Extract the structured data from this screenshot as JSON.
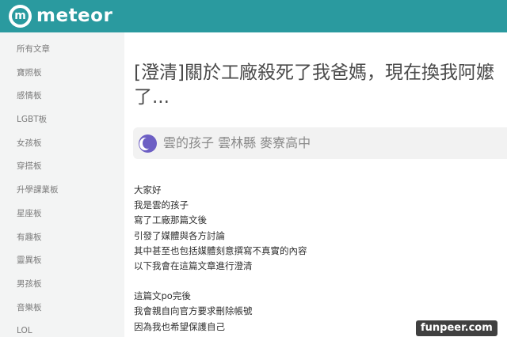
{
  "brand": {
    "logo_glyph": "m",
    "name": "meteor",
    "color": "#2a9a9f"
  },
  "sidebar": {
    "items": [
      {
        "label": "所有文章"
      },
      {
        "label": "寶照板"
      },
      {
        "label": "感情板"
      },
      {
        "label": "LGBT板"
      },
      {
        "label": "女孩板"
      },
      {
        "label": "穿搭板"
      },
      {
        "label": "升學課業板"
      },
      {
        "label": "星座板"
      },
      {
        "label": "有趣板"
      },
      {
        "label": "靈異板"
      },
      {
        "label": "男孩板"
      },
      {
        "label": "音樂板"
      },
      {
        "label": "LOL"
      }
    ]
  },
  "post": {
    "title": "[澄清]關於工廠殺死了我爸媽，現在換我阿嬤了...",
    "author": {
      "name": "雲的孩子 雲林縣 麥寮高中",
      "avatar": "moon-avatar-icon",
      "avatar_color": "#6d5fc4"
    },
    "paragraph1": [
      "大家好",
      "我是雲的孩子",
      "寫了工廠那篇文後",
      "引發了媒體與各方討論",
      "其中甚至也包括媒體刻意撰寫不真實的內容",
      "以下我會在這篇文章進行澄清"
    ],
    "paragraph2": [
      "這篇文po完後",
      "我會親自向官方要求刪除帳號",
      "因為我也希望保護自己"
    ]
  },
  "watermark": "funpeer.com"
}
